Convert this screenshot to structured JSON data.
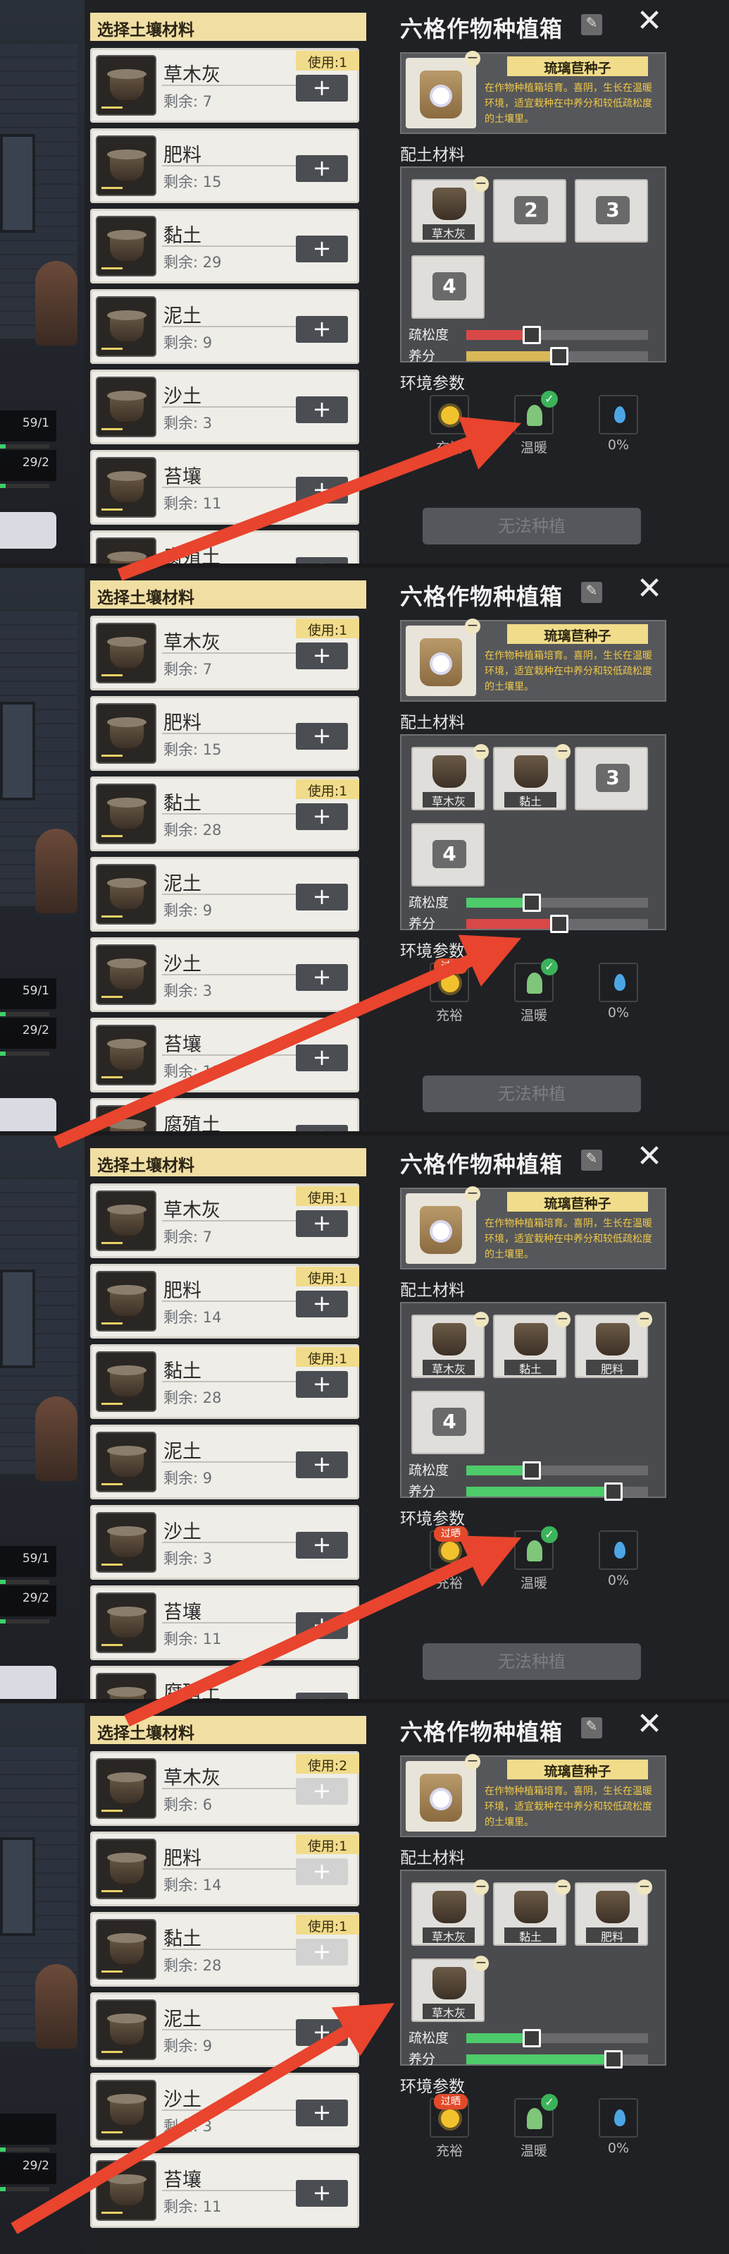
{
  "panels": [
    {
      "scene": {
        "stat1": "59/1",
        "stat2": "29/2"
      },
      "list_header": "选择土壤材料",
      "items": [
        {
          "name": "草木灰",
          "remaining": "剩余: 7",
          "usage": "使用:1"
        },
        {
          "name": "肥料",
          "remaining": "剩余: 15",
          "usage": ""
        },
        {
          "name": "黏土",
          "remaining": "剩余: 29",
          "usage": ""
        },
        {
          "name": "泥土",
          "remaining": "剩余: 9",
          "usage": ""
        },
        {
          "name": "沙土",
          "remaining": "剩余: 3",
          "usage": ""
        },
        {
          "name": "苔壤",
          "remaining": "剩余: 11",
          "usage": ""
        },
        {
          "name": "腐殖土",
          "remaining": "",
          "usage": ""
        }
      ],
      "box_title": "六格作物种植箱",
      "seed_name": "琉璃苣种子",
      "seed_desc": "在作物种植箱培育。喜阴，生长在温暖环境，适宜栽种在中养分和较低疏松度的土壤里。",
      "soil_label": "配土材料",
      "slots": [
        "草木灰",
        "2",
        "3",
        "4"
      ],
      "looseness_label": "疏松度",
      "nutrient_label": "养分",
      "looseness": 0.15,
      "nutrient": 0.3,
      "env_label": "环境参数",
      "env": {
        "sun": "充裕",
        "temp": "温暖",
        "water": "0%",
        "sun_badge": ""
      },
      "plant_button": "无法种植"
    },
    {
      "scene": {
        "stat1": "59/1",
        "stat2": "29/2"
      },
      "list_header": "选择土壤材料",
      "items": [
        {
          "name": "草木灰",
          "remaining": "剩余: 7",
          "usage": "使用:1"
        },
        {
          "name": "肥料",
          "remaining": "剩余: 15",
          "usage": ""
        },
        {
          "name": "黏土",
          "remaining": "剩余: 28",
          "usage": "使用:1"
        },
        {
          "name": "泥土",
          "remaining": "剩余: 9",
          "usage": ""
        },
        {
          "name": "沙土",
          "remaining": "剩余: 3",
          "usage": ""
        },
        {
          "name": "苔壤",
          "remaining": "剩余: 11",
          "usage": ""
        },
        {
          "name": "腐殖土",
          "remaining": "",
          "usage": ""
        }
      ],
      "box_title": "六格作物种植箱",
      "seed_name": "琉璃苣种子",
      "seed_desc": "在作物种植箱培育。喜阴，生长在温暖环境，适宜栽种在中养分和较低疏松度的土壤里。",
      "soil_label": "配土材料",
      "slots": [
        "草木灰",
        "黏土",
        "3",
        "4"
      ],
      "looseness_label": "疏松度",
      "nutrient_label": "养分",
      "looseness": 0.15,
      "nutrient": 0.3,
      "env_label": "环境参数",
      "env": {
        "sun": "充裕",
        "temp": "温暖",
        "water": "0%",
        "sun_badge": "过晒"
      },
      "plant_button": "无法种植"
    },
    {
      "scene": {
        "stat1": "59/1",
        "stat2": "29/2"
      },
      "list_header": "选择土壤材料",
      "items": [
        {
          "name": "草木灰",
          "remaining": "剩余: 7",
          "usage": "使用:1"
        },
        {
          "name": "肥料",
          "remaining": "剩余: 14",
          "usage": "使用:1"
        },
        {
          "name": "黏土",
          "remaining": "剩余: 28",
          "usage": "使用:1"
        },
        {
          "name": "泥土",
          "remaining": "剩余: 9",
          "usage": ""
        },
        {
          "name": "沙土",
          "remaining": "剩余: 3",
          "usage": ""
        },
        {
          "name": "苔壤",
          "remaining": "剩余: 11",
          "usage": ""
        },
        {
          "name": "腐殖土",
          "remaining": "",
          "usage": ""
        }
      ],
      "box_title": "六格作物种植箱",
      "seed_name": "琉璃苣种子",
      "seed_desc": "在作物种植箱培育。喜阴，生长在温暖环境，适宜栽种在中养分和较低疏松度的土壤里。",
      "soil_label": "配土材料",
      "slots": [
        "草木灰",
        "黏土",
        "肥料",
        "4"
      ],
      "looseness_label": "疏松度",
      "nutrient_label": "养分",
      "looseness": 0.15,
      "nutrient": 0.6,
      "env_label": "环境参数",
      "env": {
        "sun": "充裕",
        "temp": "温暖",
        "water": "0%",
        "sun_badge": "过晒"
      },
      "plant_button": "无法种植"
    },
    {
      "scene": {
        "stat1": "",
        "stat2": "29/2"
      },
      "list_header": "选择土壤材料",
      "items": [
        {
          "name": "草木灰",
          "remaining": "剩余: 6",
          "usage": "使用:2"
        },
        {
          "name": "肥料",
          "remaining": "剩余: 14",
          "usage": "使用:1"
        },
        {
          "name": "黏土",
          "remaining": "剩余: 28",
          "usage": "使用:1"
        },
        {
          "name": "泥土",
          "remaining": "剩余: 9",
          "usage": ""
        },
        {
          "name": "沙土",
          "remaining": "剩余: 3",
          "usage": ""
        },
        {
          "name": "苔壤",
          "remaining": "剩余: 11",
          "usage": ""
        }
      ],
      "box_title": "六格作物种植箱",
      "seed_name": "琉璃苣种子",
      "seed_desc": "在作物种植箱培育。喜阴，生长在温暖环境，适宜栽种在中养分和较低疏松度的土壤里。",
      "soil_label": "配土材料",
      "slots": [
        "草木灰",
        "黏土",
        "肥料",
        "草木灰"
      ],
      "looseness_label": "疏松度",
      "nutrient_label": "养分",
      "looseness": 0.15,
      "nutrient": 0.6,
      "env_label": "环境参数",
      "env": {
        "sun": "充裕",
        "temp": "温暖",
        "water": "0%",
        "sun_badge": "过晒"
      },
      "plant_button": ""
    }
  ],
  "colors": {
    "arrow": "#e8442e",
    "looseness_bad": "#d94848",
    "good": "#4ecb6a",
    "nutrient_mid": "#d8b858"
  }
}
